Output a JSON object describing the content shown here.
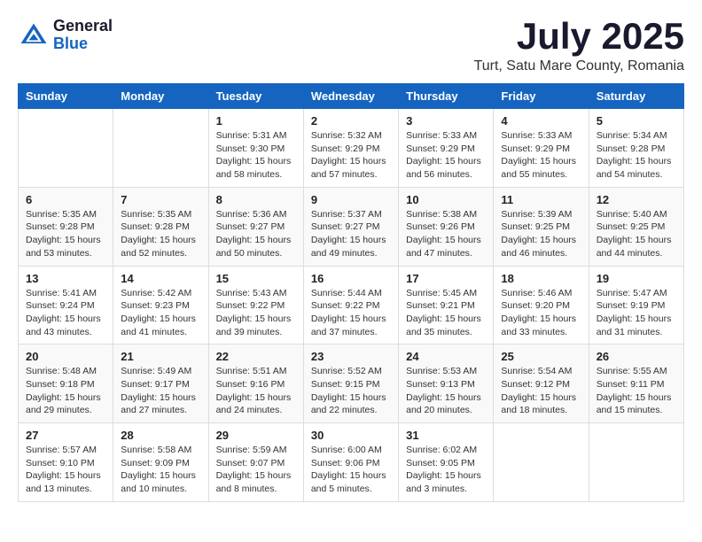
{
  "header": {
    "logo_general": "General",
    "logo_blue": "Blue",
    "month_year": "July 2025",
    "location": "Turt, Satu Mare County, Romania"
  },
  "days_of_week": [
    "Sunday",
    "Monday",
    "Tuesday",
    "Wednesday",
    "Thursday",
    "Friday",
    "Saturday"
  ],
  "weeks": [
    [
      {
        "day": "",
        "info": ""
      },
      {
        "day": "",
        "info": ""
      },
      {
        "day": "1",
        "info": "Sunrise: 5:31 AM\nSunset: 9:30 PM\nDaylight: 15 hours and 58 minutes."
      },
      {
        "day": "2",
        "info": "Sunrise: 5:32 AM\nSunset: 9:29 PM\nDaylight: 15 hours and 57 minutes."
      },
      {
        "day": "3",
        "info": "Sunrise: 5:33 AM\nSunset: 9:29 PM\nDaylight: 15 hours and 56 minutes."
      },
      {
        "day": "4",
        "info": "Sunrise: 5:33 AM\nSunset: 9:29 PM\nDaylight: 15 hours and 55 minutes."
      },
      {
        "day": "5",
        "info": "Sunrise: 5:34 AM\nSunset: 9:28 PM\nDaylight: 15 hours and 54 minutes."
      }
    ],
    [
      {
        "day": "6",
        "info": "Sunrise: 5:35 AM\nSunset: 9:28 PM\nDaylight: 15 hours and 53 minutes."
      },
      {
        "day": "7",
        "info": "Sunrise: 5:35 AM\nSunset: 9:28 PM\nDaylight: 15 hours and 52 minutes."
      },
      {
        "day": "8",
        "info": "Sunrise: 5:36 AM\nSunset: 9:27 PM\nDaylight: 15 hours and 50 minutes."
      },
      {
        "day": "9",
        "info": "Sunrise: 5:37 AM\nSunset: 9:27 PM\nDaylight: 15 hours and 49 minutes."
      },
      {
        "day": "10",
        "info": "Sunrise: 5:38 AM\nSunset: 9:26 PM\nDaylight: 15 hours and 47 minutes."
      },
      {
        "day": "11",
        "info": "Sunrise: 5:39 AM\nSunset: 9:25 PM\nDaylight: 15 hours and 46 minutes."
      },
      {
        "day": "12",
        "info": "Sunrise: 5:40 AM\nSunset: 9:25 PM\nDaylight: 15 hours and 44 minutes."
      }
    ],
    [
      {
        "day": "13",
        "info": "Sunrise: 5:41 AM\nSunset: 9:24 PM\nDaylight: 15 hours and 43 minutes."
      },
      {
        "day": "14",
        "info": "Sunrise: 5:42 AM\nSunset: 9:23 PM\nDaylight: 15 hours and 41 minutes."
      },
      {
        "day": "15",
        "info": "Sunrise: 5:43 AM\nSunset: 9:22 PM\nDaylight: 15 hours and 39 minutes."
      },
      {
        "day": "16",
        "info": "Sunrise: 5:44 AM\nSunset: 9:22 PM\nDaylight: 15 hours and 37 minutes."
      },
      {
        "day": "17",
        "info": "Sunrise: 5:45 AM\nSunset: 9:21 PM\nDaylight: 15 hours and 35 minutes."
      },
      {
        "day": "18",
        "info": "Sunrise: 5:46 AM\nSunset: 9:20 PM\nDaylight: 15 hours and 33 minutes."
      },
      {
        "day": "19",
        "info": "Sunrise: 5:47 AM\nSunset: 9:19 PM\nDaylight: 15 hours and 31 minutes."
      }
    ],
    [
      {
        "day": "20",
        "info": "Sunrise: 5:48 AM\nSunset: 9:18 PM\nDaylight: 15 hours and 29 minutes."
      },
      {
        "day": "21",
        "info": "Sunrise: 5:49 AM\nSunset: 9:17 PM\nDaylight: 15 hours and 27 minutes."
      },
      {
        "day": "22",
        "info": "Sunrise: 5:51 AM\nSunset: 9:16 PM\nDaylight: 15 hours and 24 minutes."
      },
      {
        "day": "23",
        "info": "Sunrise: 5:52 AM\nSunset: 9:15 PM\nDaylight: 15 hours and 22 minutes."
      },
      {
        "day": "24",
        "info": "Sunrise: 5:53 AM\nSunset: 9:13 PM\nDaylight: 15 hours and 20 minutes."
      },
      {
        "day": "25",
        "info": "Sunrise: 5:54 AM\nSunset: 9:12 PM\nDaylight: 15 hours and 18 minutes."
      },
      {
        "day": "26",
        "info": "Sunrise: 5:55 AM\nSunset: 9:11 PM\nDaylight: 15 hours and 15 minutes."
      }
    ],
    [
      {
        "day": "27",
        "info": "Sunrise: 5:57 AM\nSunset: 9:10 PM\nDaylight: 15 hours and 13 minutes."
      },
      {
        "day": "28",
        "info": "Sunrise: 5:58 AM\nSunset: 9:09 PM\nDaylight: 15 hours and 10 minutes."
      },
      {
        "day": "29",
        "info": "Sunrise: 5:59 AM\nSunset: 9:07 PM\nDaylight: 15 hours and 8 minutes."
      },
      {
        "day": "30",
        "info": "Sunrise: 6:00 AM\nSunset: 9:06 PM\nDaylight: 15 hours and 5 minutes."
      },
      {
        "day": "31",
        "info": "Sunrise: 6:02 AM\nSunset: 9:05 PM\nDaylight: 15 hours and 3 minutes."
      },
      {
        "day": "",
        "info": ""
      },
      {
        "day": "",
        "info": ""
      }
    ]
  ]
}
